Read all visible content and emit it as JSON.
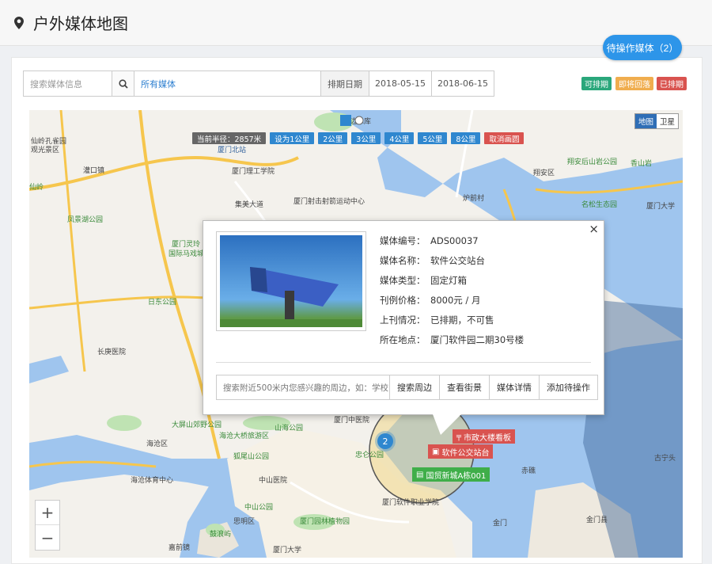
{
  "header": {
    "title": "户外媒体地图"
  },
  "pending": {
    "label": "待操作媒体（2）"
  },
  "toolbar": {
    "search_placeholder": "搜索媒体信息",
    "media_select": "所有媒体",
    "date_label": "排期日期",
    "date_start": "2018-05-15",
    "date_end": "2018-06-15"
  },
  "legend": [
    {
      "label": "可排期",
      "color": "#2aa77b"
    },
    {
      "label": "即将回落",
      "color": "#f0ad4e"
    },
    {
      "label": "已排期",
      "color": "#d9534f"
    }
  ],
  "map": {
    "radius_info": "当前半径：2857米",
    "radius_buttons": [
      "设为1公里",
      "2公里",
      "3公里",
      "4公里",
      "5公里",
      "8公里"
    ],
    "clear_label": "取消画圆",
    "type_map": "地图",
    "type_satellite": "卫星",
    "zoom_in": "+",
    "zoom_out": "−",
    "cluster_count": "2",
    "labels": [
      "仙岭孔雀园",
      "观光景区",
      "灌口镇",
      "凤景湖公园",
      "仙岭",
      "厦门灵玲",
      "国际马戏城",
      "日东公园",
      "长庚医院",
      "大屏山郊野公园",
      "海沧大桥旅游区",
      "海沧区",
      "狐尾山公园",
      "海沧体育中心",
      "中山医院",
      "中山公园",
      "思明区",
      "鼓浪屿",
      "厦门园林植物园",
      "厦门大学",
      "厦门理工学院",
      "厦门射击射箭运动中心",
      "翔安区",
      "翔安后山岩公园",
      "香山岩",
      "名松生态园",
      "厦门大学",
      "炉前村",
      "赤礁",
      "金门",
      "金门县",
      "嘉前镜",
      "厦门北站",
      "集美大道",
      "厦门中医院",
      "忠仑公园",
      "厦门软件职业学院",
      "湖边水库",
      "古宁头",
      "山海公园"
    ]
  },
  "popup": {
    "close": "×",
    "fields": [
      {
        "key": "媒体编号：",
        "value": "ADS00037"
      },
      {
        "key": "媒体名称：",
        "value": "软件公交站台"
      },
      {
        "key": "媒体类型：",
        "value": "固定灯箱"
      },
      {
        "key": "刊例价格：",
        "value": "8000元 / 月"
      },
      {
        "key": "上刊情况：",
        "value": "已排期，不可售"
      },
      {
        "key": "所在地点：",
        "value": "厦门软件园二期30号楼"
      }
    ],
    "nearby_placeholder": "搜索附近500米内您感兴趣的周边，如：学校",
    "actions": [
      "搜索周边",
      "查看街景",
      "媒体详情",
      "添加待操作"
    ]
  },
  "markers": [
    {
      "label": "市政大楼看板",
      "color": "#d9534f"
    },
    {
      "label": "软件公交站台",
      "color": "#d9534f"
    },
    {
      "label": "国贸新城A栋001",
      "color": "#3fae49"
    }
  ]
}
